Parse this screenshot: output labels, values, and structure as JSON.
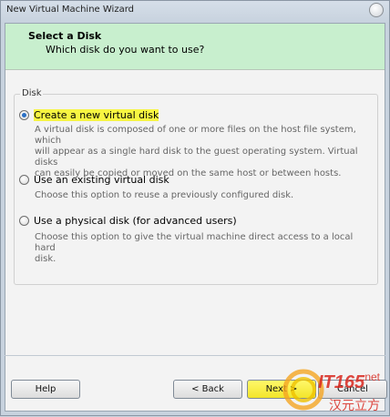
{
  "window": {
    "title": "New Virtual Machine Wizard"
  },
  "header": {
    "title": "Select a Disk",
    "subtitle": "Which disk do you want to use?"
  },
  "disk_group": {
    "label": "Disk",
    "options": [
      {
        "label": "Create a new virtual disk",
        "selected": true,
        "description_lines": [
          "A virtual disk is composed of one or more files on the host file system, which",
          "will appear as a single hard disk to the guest operating system. Virtual disks",
          "can easily be copied or moved on the same host or between hosts."
        ]
      },
      {
        "label": "Use an existing virtual disk",
        "selected": false,
        "description_lines": [
          "Choose this option to reuse a previously configured disk."
        ]
      },
      {
        "label": "Use a physical disk (for advanced users)",
        "selected": false,
        "description_lines": [
          "Choose this option to give the virtual machine direct access to a local hard",
          "disk."
        ]
      }
    ]
  },
  "buttons": {
    "help": "Help",
    "back": "< Back",
    "next": "Next >",
    "cancel": "Cancel"
  },
  "watermark": {
    "brand": "IT165",
    "suffix": ".net",
    "cn": "汉元立方"
  },
  "colors": {
    "header_bg": "#c8efce",
    "highlight": "#f7f542",
    "watermark_red": "#d9281f"
  }
}
